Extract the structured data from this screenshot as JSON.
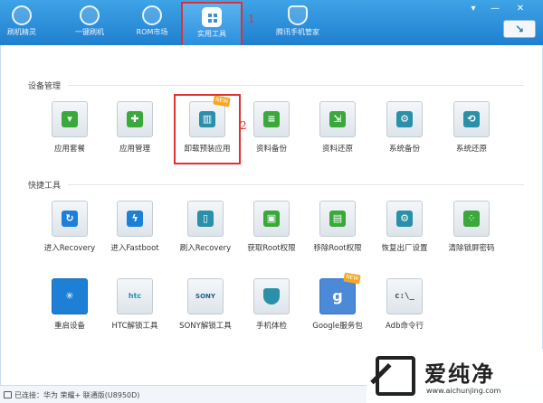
{
  "toolbar": {
    "tabs": [
      {
        "label": "刷机精灵",
        "icon": "app-logo-icon"
      },
      {
        "label": "一键刷机",
        "icon": "cursor-icon"
      },
      {
        "label": "ROM市场",
        "icon": "android-icon"
      },
      {
        "label": "实用工具",
        "icon": "grid-icon",
        "active": true
      },
      {
        "label": "腾讯手机管家",
        "icon": "shield-icon"
      }
    ],
    "annotation_1": "1",
    "window_buttons": {
      "menu": "▾",
      "minimize": "—",
      "close": "✕"
    },
    "back_arrow": "↘"
  },
  "device_management": {
    "title": "设备管理",
    "annotation_2": "2",
    "items": [
      {
        "label": "应用套餐",
        "icon": "shopping-bag-icon"
      },
      {
        "label": "应用管理",
        "icon": "puzzle-icon"
      },
      {
        "label": "卸载预装应用",
        "icon": "trash-icon",
        "badge": "NEW"
      },
      {
        "label": "资料备份",
        "icon": "document-backup-icon"
      },
      {
        "label": "资料还原",
        "icon": "document-restore-icon"
      },
      {
        "label": "系统备份",
        "icon": "system-backup-icon"
      },
      {
        "label": "系统还原",
        "icon": "system-restore-icon"
      }
    ]
  },
  "quick_tools": {
    "title": "快捷工具",
    "row1": [
      {
        "label": "进入Recovery",
        "icon": "refresh-icon"
      },
      {
        "label": "进入Fastboot",
        "icon": "lightning-icon"
      },
      {
        "label": "刷入Recovery",
        "icon": "tablet-icon"
      },
      {
        "label": "获取Root权限",
        "icon": "android-root-icon"
      },
      {
        "label": "移除Root权限",
        "icon": "android-unroot-icon"
      },
      {
        "label": "恢复出厂设置",
        "icon": "gears-icon"
      },
      {
        "label": "清除锁屏密码",
        "icon": "pattern-lock-icon"
      }
    ],
    "row2": [
      {
        "label": "重启设备",
        "icon": "spinner-icon"
      },
      {
        "label": "HTC解锁工具",
        "icon": "htc-lock-icon",
        "text": "htc"
      },
      {
        "label": "SONY解锁工具",
        "icon": "sony-lock-icon",
        "text": "SONY"
      },
      {
        "label": "手机体检",
        "icon": "checkup-shield-icon"
      },
      {
        "label": "Google服务包",
        "icon": "google-icon",
        "text": "g",
        "badge": "NEW"
      },
      {
        "label": "Adb命令行",
        "icon": "terminal-icon",
        "text": "c:\\_"
      }
    ]
  },
  "status_bar": {
    "text": "已连接：华为 荣耀+ 联通版(U8950D)"
  },
  "watermark": {
    "name": "爱纯净",
    "url": "www.aichunjing.com"
  },
  "colors": {
    "toolbar": "#2b8fde",
    "annotation": "#e23030",
    "accent_blue": "#1e7fd6"
  }
}
